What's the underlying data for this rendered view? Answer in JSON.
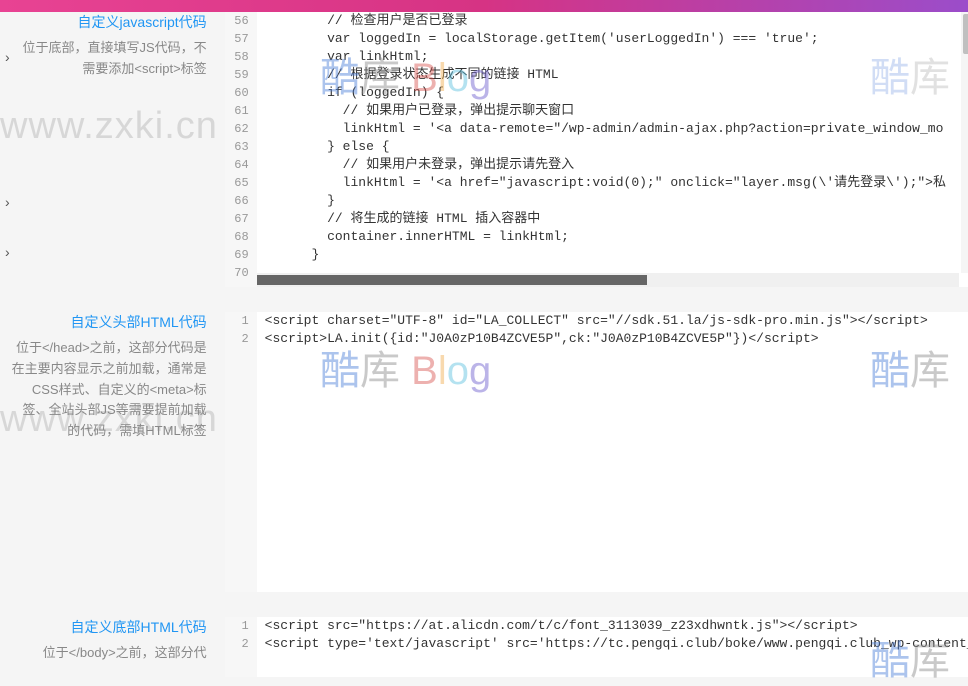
{
  "sections": {
    "js": {
      "title": "自定义javascript代码",
      "desc": "位于底部，直接填写JS代码，不需要添加<script>标签",
      "startLine": 56,
      "lines": [
        "        // 检查用户是否已登录",
        "        var loggedIn = localStorage.getItem('userLoggedIn') === 'true';",
        "        var linkHtml;",
        "        // 根据登录状态生成不同的链接 HTML",
        "        if (loggedIn) {",
        "          // 如果用户已登录，弹出提示聊天窗口",
        "          linkHtml = '<a data-remote=\"/wp-admin/admin-ajax.php?action=private_window_mo",
        "        } else {",
        "          // 如果用户未登录，弹出提示请先登入",
        "          linkHtml = '<a href=\"javascript:void(0);\" onclick=\"layer.msg(\\'请先登录\\');\">私",
        "        }",
        "        // 将生成的链接 HTML 插入容器中",
        "        container.innerHTML = linkHtml;",
        "      }",
        ""
      ]
    },
    "head": {
      "title": "自定义头部HTML代码",
      "desc": "位于</head>之前，这部分代码是在主要内容显示之前加载，通常是CSS样式、自定义的<meta>标签、全站头部JS等需要提前加载的代码，需填HTML标签",
      "startLine": 1,
      "lines": [
        "<script charset=\"UTF-8\" id=\"LA_COLLECT\" src=\"//sdk.51.la/js-sdk-pro.min.js\"></script>",
        "<script>LA.init({id:\"J0A0zP10B4ZCVE5P\",ck:\"J0A0zP10B4ZCVE5P\"})</script>"
      ]
    },
    "foot": {
      "title": "自定义底部HTML代码",
      "desc": "位于</body>之前，这部分代",
      "startLine": 1,
      "lines": [
        "<script src=\"https://at.alicdn.com/t/c/font_3113039_z23xdhwntk.js\"></script>",
        "<script type='text/javascript' src='https://tc.pengqi.club/boke/www.pengqi.club_wp-content_"
      ]
    }
  },
  "watermarks": {
    "url": "www.zxki.cn",
    "brand_chars": [
      "酷",
      "库",
      " ",
      "B",
      "l",
      "o",
      "g"
    ]
  }
}
